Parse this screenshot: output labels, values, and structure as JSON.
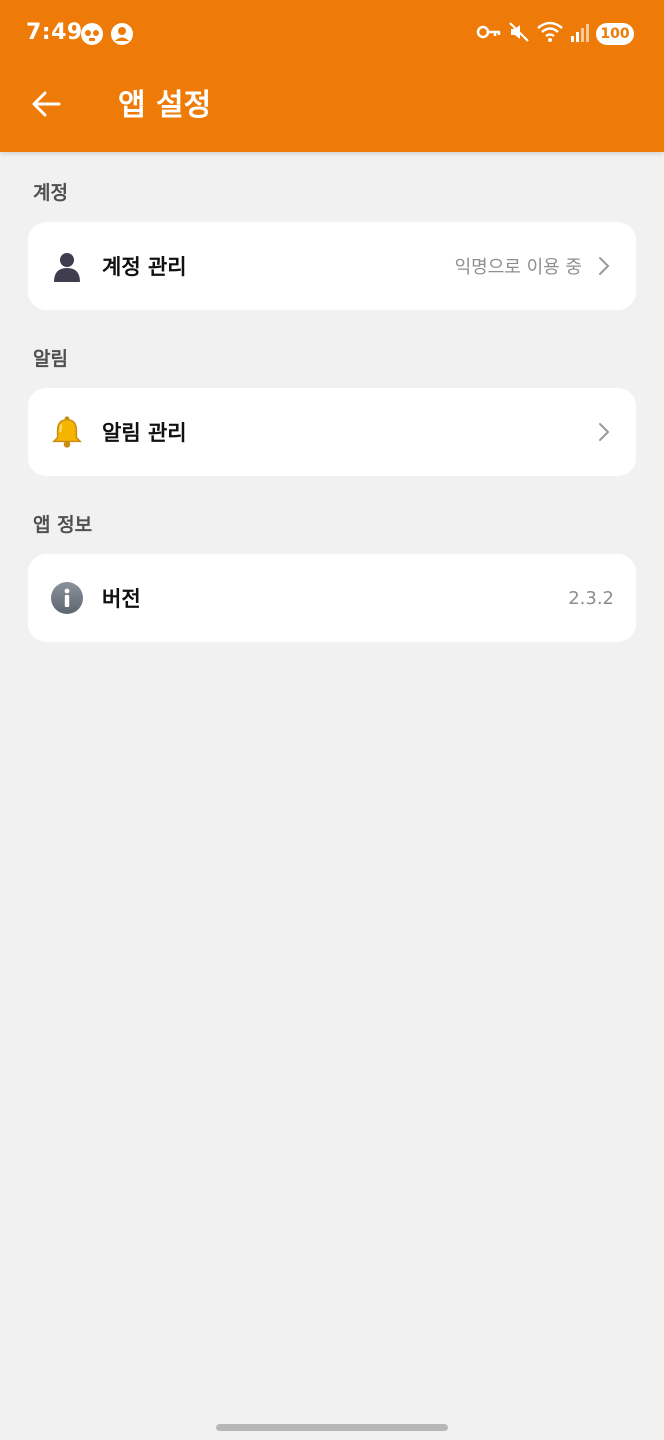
{
  "status_bar": {
    "time": "7:49",
    "battery": "100"
  },
  "app_bar": {
    "title": "앱 설정",
    "back_icon": "arrow-left-icon"
  },
  "sections": [
    {
      "label": "계정",
      "item": {
        "title": "계정 관리",
        "value": "익명으로 이용 중",
        "icon": "person-silhouette-icon"
      }
    },
    {
      "label": "알림",
      "item": {
        "title": "알림 관리",
        "value": "",
        "icon": "bell-icon"
      }
    },
    {
      "label": "앱 정보",
      "item": {
        "title": "버전",
        "value": "2.3.2",
        "icon": "info-icon"
      }
    }
  ],
  "colors": {
    "accent": "#ee7b07",
    "background": "#f1f1f1",
    "card": "#ffffff"
  }
}
